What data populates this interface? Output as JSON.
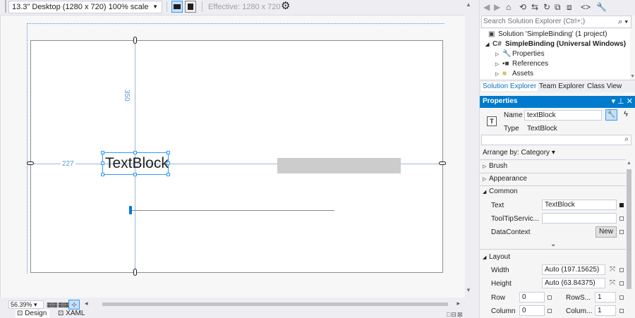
{
  "designer": {
    "device": "13.3\" Desktop (1280 x 720) 100% scale",
    "effective": "Effective: 1280 x 720",
    "dim_top": "350",
    "dim_left": "227",
    "textblock_text": "TextBlock",
    "zoom": "56.39%",
    "tab_design": "Design",
    "tab_xaml": "XAML"
  },
  "solution_explorer": {
    "search_placeholder": "Search Solution Explorer (Ctrl+;)",
    "tree": [
      {
        "label": "Solution 'SimpleBinding' (1 project)"
      },
      {
        "label": "SimpleBinding (Universal Windows)"
      },
      {
        "label": "Properties"
      },
      {
        "label": "References"
      },
      {
        "label": "Assets"
      }
    ],
    "tabs": [
      "Solution Explorer",
      "Team Explorer",
      "Class View"
    ]
  },
  "properties": {
    "header": "Properties",
    "name_label": "Name",
    "name_value": "textBlock",
    "type_label": "Type",
    "type_value": "TextBlock",
    "arrange": "Arrange by: Category ▾",
    "categories": {
      "brush": "Brush",
      "appearance": "Appearance",
      "common": "Common",
      "layout": "Layout"
    },
    "common": {
      "text_label": "Text",
      "text_value": "TextBlock",
      "tooltip_label": "ToolTipServic...",
      "tooltip_value": "",
      "datacontext_label": "DataContext",
      "new_button": "New"
    },
    "layout": {
      "width_label": "Width",
      "width_value": "Auto (197.15625)",
      "height_label": "Height",
      "height_value": "Auto (63.84375)",
      "row_label": "Row",
      "row_value": "0",
      "rowspan_label": "RowS...",
      "rowspan_value": "1",
      "column_label": "Column",
      "column_value": "0",
      "colspan_label": "Colum...",
      "colspan_value": "1"
    }
  },
  "colors": {
    "accent": "#007acc",
    "selection": "#3399ff"
  }
}
